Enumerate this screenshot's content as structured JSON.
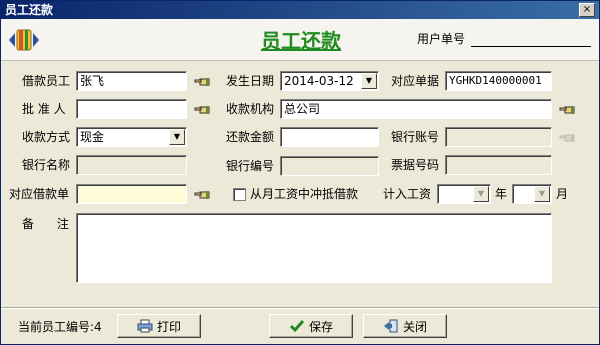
{
  "window": {
    "title": "员工还款",
    "close_label": "×"
  },
  "header": {
    "form_title": "员工还款",
    "user_no_label": "用户单号",
    "user_no_value": ""
  },
  "fields": {
    "borrower_label": "借款员工",
    "borrower_value": "张飞",
    "date_label": "发生日期",
    "date_value": "2014-03-12",
    "doc_no_label": "对应单据",
    "doc_no_value": "YGHKD140000001",
    "approver_label": "批 准 人",
    "approver_value": "",
    "receiver_label": "收款机构",
    "receiver_value": "总公司",
    "pay_method_label": "收款方式",
    "pay_method_value": "现金",
    "amount_label": "还款金额",
    "amount_value": "",
    "bank_account_label": "银行账号",
    "bank_account_value": "",
    "bank_name_label": "银行名称",
    "bank_name_value": "",
    "bank_code_label": "银行编号",
    "bank_code_value": "",
    "receipt_no_label": "票据号码",
    "receipt_no_value": "",
    "loan_doc_label": "对应借款单",
    "loan_doc_value": "",
    "deduct_label": "从月工资中冲抵借款",
    "salary_label": "计入工资",
    "year_value": "",
    "year_unit": "年",
    "month_value": "",
    "month_unit": "月",
    "remark_label": "备      注",
    "remark_value": ""
  },
  "footer": {
    "current_emp_label": "当前员工编号:4",
    "print_label": "打印",
    "save_label": "保存",
    "close_label": "关闭"
  },
  "icons": {
    "app": "folder-pencil-icon",
    "lookup": "hand-pointer-icon",
    "print": "printer-icon",
    "save": "checkmark-icon",
    "close": "exit-door-icon"
  },
  "colors": {
    "title_green": "#1f8a1f",
    "titlebar": "#0a246a",
    "loan_doc_bg": "#fffbd6"
  }
}
